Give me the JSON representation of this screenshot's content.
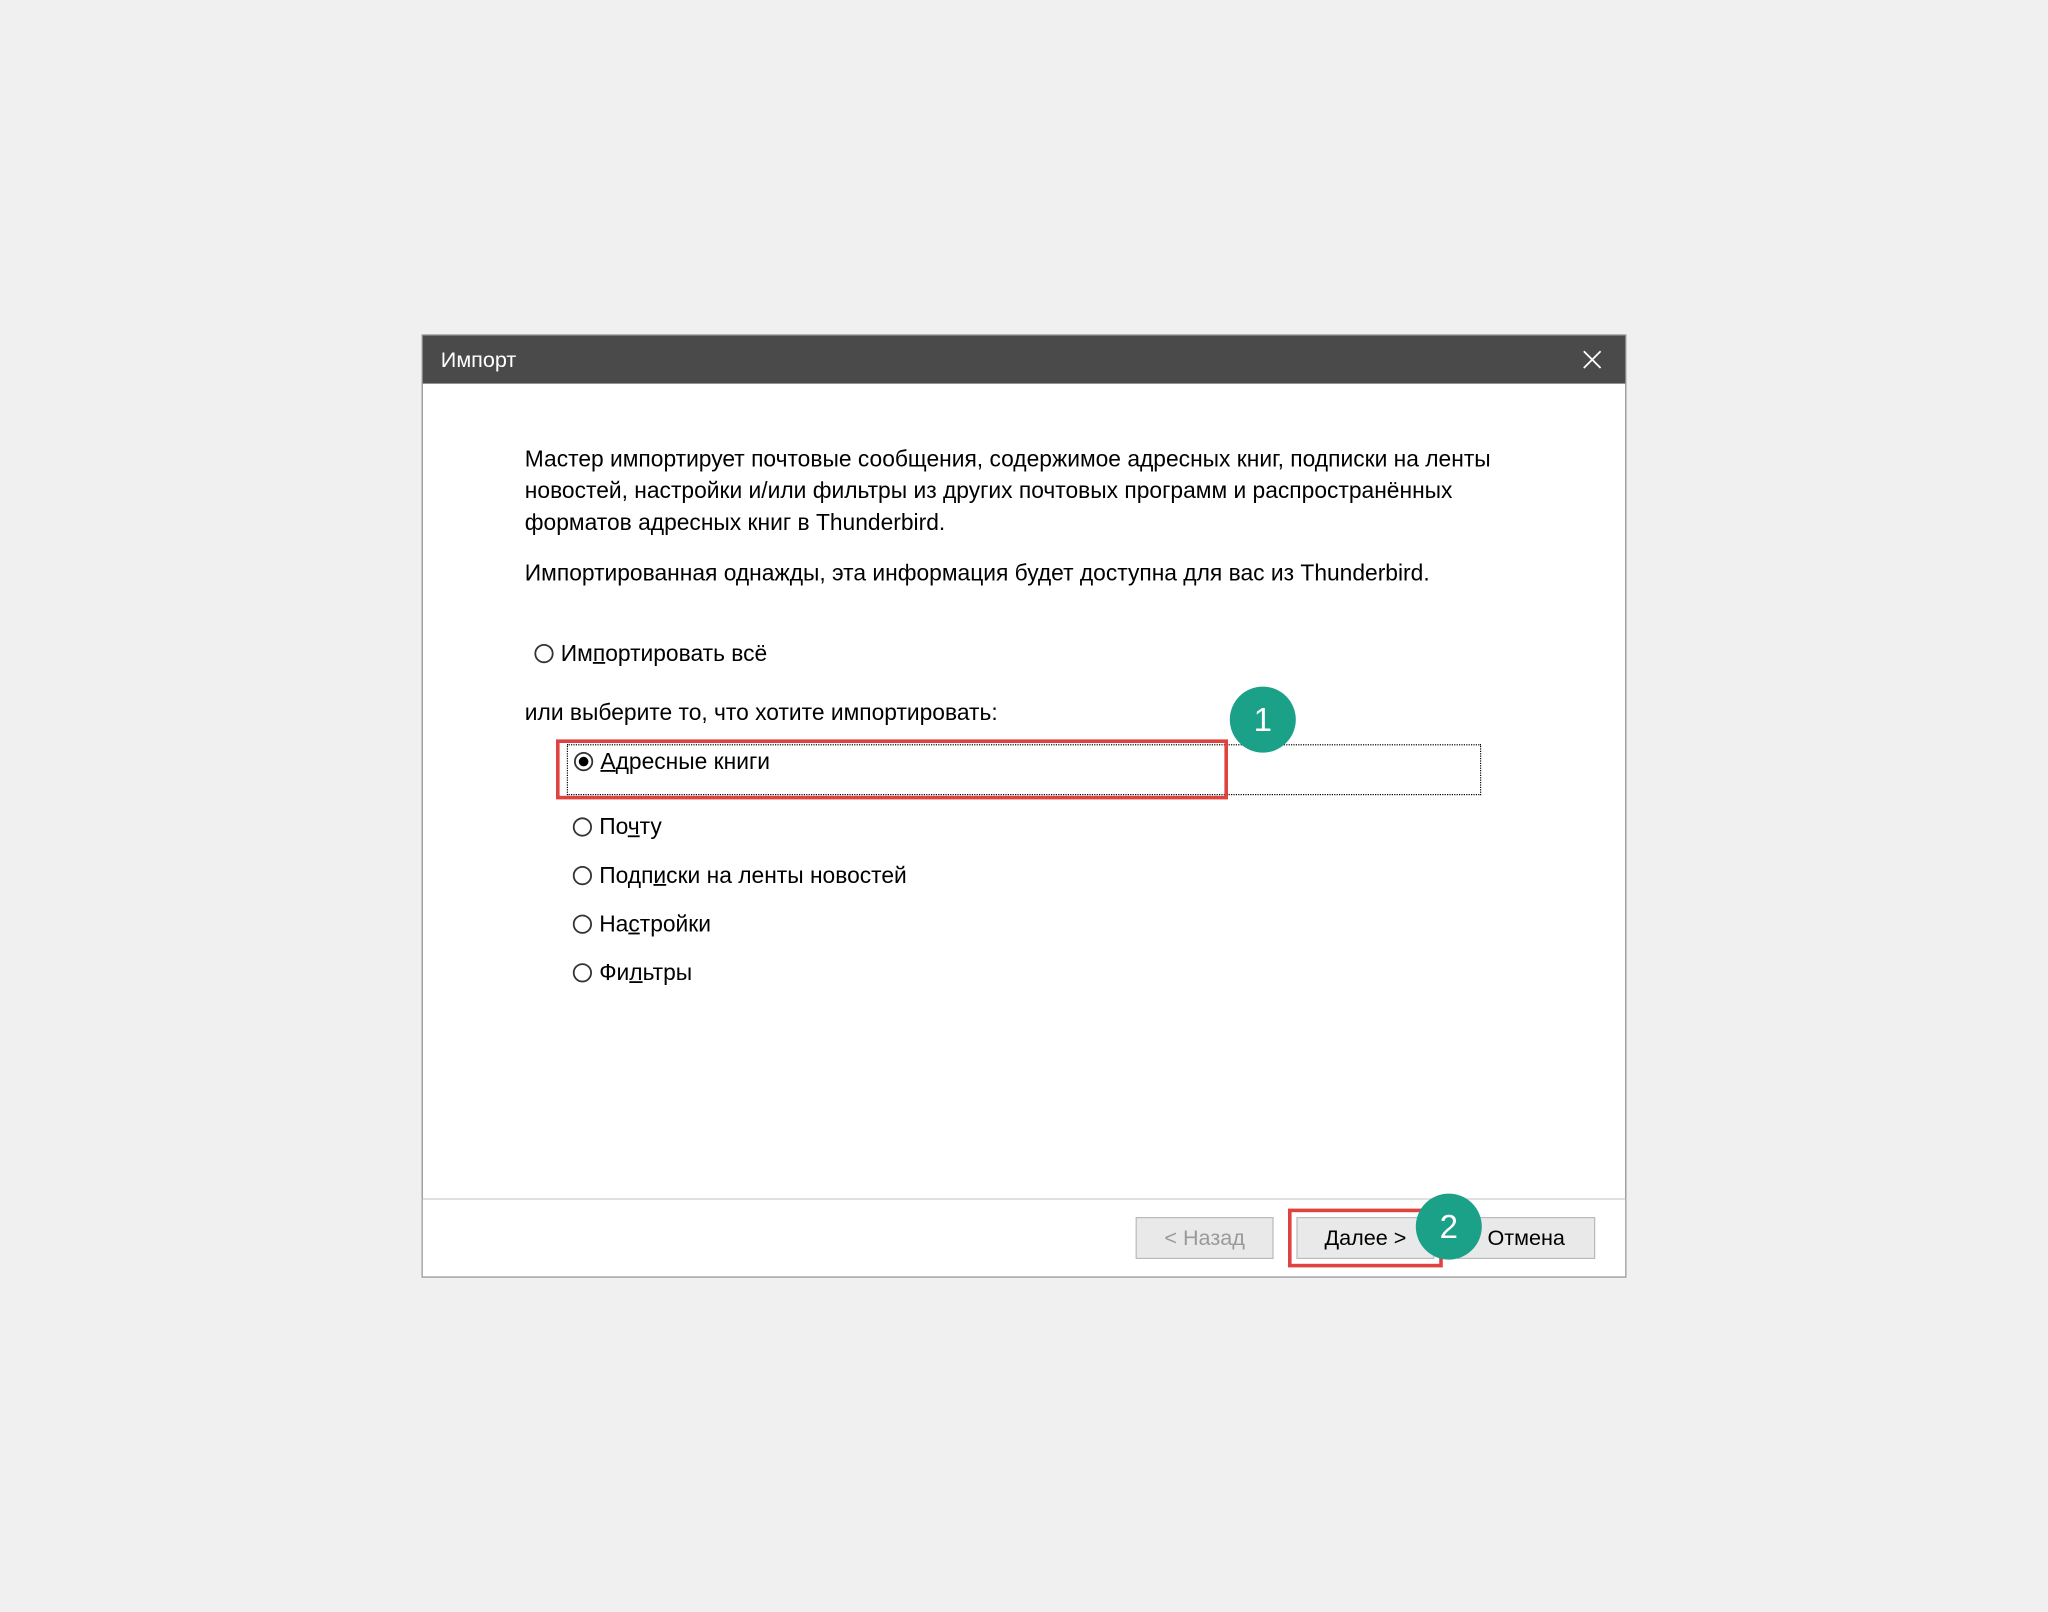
{
  "titlebar": {
    "title": "Импорт"
  },
  "intro": {
    "p1": "Мастер импортирует почтовые сообщения, содержимое адресных книг, подписки на ленты новостей, настройки и/или фильтры из других почтовых программ и распространённых форматов адресных книг в Thunderbird.",
    "p2": "Импортированная однажды, эта информация будет доступна для вас из Thunderbird."
  },
  "options": {
    "import_all": {
      "label_pre": "Им",
      "label_u": "п",
      "label_post": "ортировать всё",
      "selected": false
    },
    "sublabel": "или выберите то, что хотите импортировать:",
    "items": [
      {
        "label_pre": "",
        "label_u": "А",
        "label_post": "дресные книги",
        "selected": true,
        "focused": true
      },
      {
        "label_pre": "По",
        "label_u": "ч",
        "label_post": "ту",
        "selected": false
      },
      {
        "label_pre": "Подп",
        "label_u": "и",
        "label_post": "ски на ленты новостей",
        "selected": false
      },
      {
        "label_pre": "На",
        "label_u": "с",
        "label_post": "тройки",
        "selected": false
      },
      {
        "label_pre": "Фи",
        "label_u": "л",
        "label_post": "ьтры",
        "selected": false
      }
    ]
  },
  "buttons": {
    "back": "< Назад",
    "next": "Далее >",
    "cancel": "Отмена"
  },
  "callouts": {
    "one": "1",
    "two": "2"
  }
}
